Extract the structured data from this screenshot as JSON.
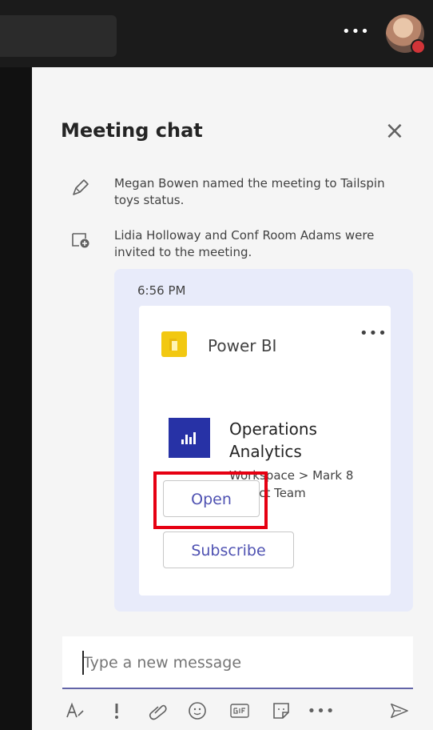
{
  "colors": {
    "top_bar": "#1b1b1b",
    "panel": "#f5f5f5",
    "message_bubble": "#e8ebfa",
    "accent": "#4f52b2",
    "power_bi": "#f2c811",
    "report_icon": "#2732a6",
    "highlight": "#e60012"
  },
  "header": {
    "more_icon": "more-icon"
  },
  "chat": {
    "title": "Meeting chat",
    "close_icon": "close-icon"
  },
  "system_messages": [
    {
      "icon": "pencil-icon",
      "text": "Megan Bowen named the meeting to Tailspin toys status."
    },
    {
      "icon": "calendar-invite-icon",
      "text": "Lidia Holloway and Conf Room Adams were invited to the meeting."
    }
  ],
  "message": {
    "time": "6:56 PM",
    "card": {
      "app_name": "Power BI",
      "more_icon": "more-icon",
      "report_title": "Operations Analytics",
      "report_path": "Workspace > Mark 8 Project Team",
      "open_label": "Open",
      "subscribe_label": "Subscribe"
    }
  },
  "compose": {
    "placeholder": "Type a new message"
  },
  "toolbar": [
    {
      "icon": "format-icon"
    },
    {
      "icon": "important-icon"
    },
    {
      "icon": "attach-icon"
    },
    {
      "icon": "emoji-icon"
    },
    {
      "icon": "gif-icon"
    },
    {
      "icon": "sticker-icon"
    },
    {
      "icon": "more-options-icon"
    },
    {
      "icon": "send-icon"
    }
  ]
}
